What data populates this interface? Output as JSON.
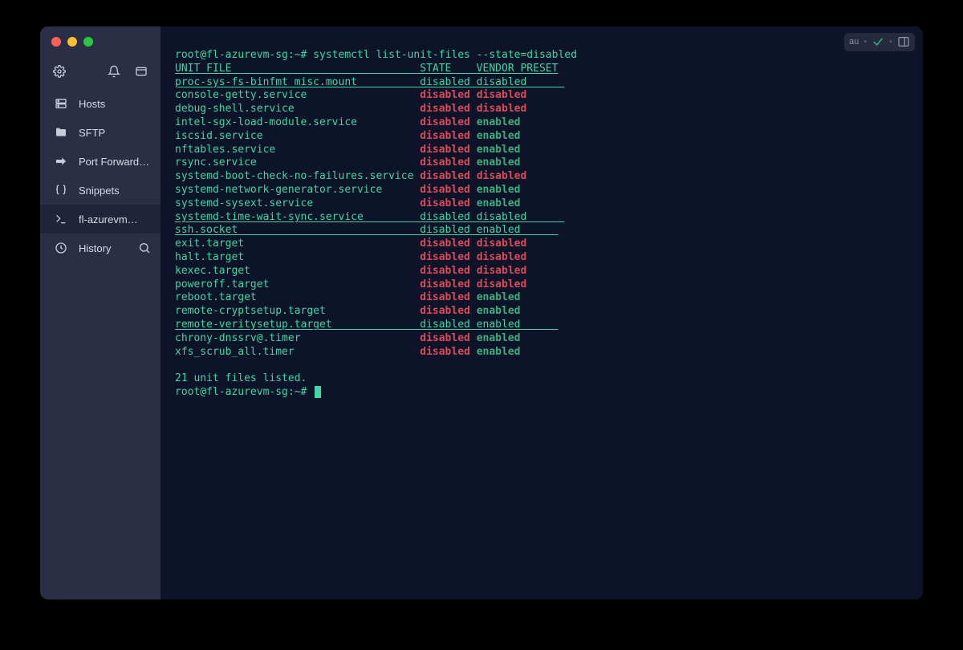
{
  "sidebar": {
    "items": [
      {
        "label": "Hosts"
      },
      {
        "label": "SFTP"
      },
      {
        "label": "Port Forwarding"
      },
      {
        "label": "Snippets"
      },
      {
        "label": "fl-azurevm…",
        "active": true
      },
      {
        "label": "History"
      }
    ]
  },
  "titlebar_badge": "au",
  "terminal": {
    "prompt": "root@fl-azurevm-sg:~#",
    "command": "systemctl list-unit-files --state=disabled",
    "header": {
      "unit": "UNIT FILE",
      "state": "STATE",
      "vendor": "VENDOR PRESET"
    },
    "rows": [
      {
        "unit": "proc-sys-fs-binfmt_misc.mount",
        "state": "disabled",
        "vendor": "disabled",
        "link": true
      },
      {
        "unit": "console-getty.service",
        "state": "disabled",
        "vendor": "disabled"
      },
      {
        "unit": "debug-shell.service",
        "state": "disabled",
        "vendor": "disabled"
      },
      {
        "unit": "intel-sgx-load-module.service",
        "state": "disabled",
        "vendor": "enabled"
      },
      {
        "unit": "iscsid.service",
        "state": "disabled",
        "vendor": "enabled"
      },
      {
        "unit": "nftables.service",
        "state": "disabled",
        "vendor": "enabled"
      },
      {
        "unit": "rsync.service",
        "state": "disabled",
        "vendor": "enabled"
      },
      {
        "unit": "systemd-boot-check-no-failures.service",
        "state": "disabled",
        "vendor": "disabled"
      },
      {
        "unit": "systemd-network-generator.service",
        "state": "disabled",
        "vendor": "enabled"
      },
      {
        "unit": "systemd-sysext.service",
        "state": "disabled",
        "vendor": "enabled"
      },
      {
        "unit": "systemd-time-wait-sync.service",
        "state": "disabled",
        "vendor": "disabled",
        "link": true
      },
      {
        "unit": "ssh.socket",
        "state": "disabled",
        "vendor": "enabled",
        "link": true
      },
      {
        "unit": "exit.target",
        "state": "disabled",
        "vendor": "disabled"
      },
      {
        "unit": "halt.target",
        "state": "disabled",
        "vendor": "disabled"
      },
      {
        "unit": "kexec.target",
        "state": "disabled",
        "vendor": "disabled"
      },
      {
        "unit": "poweroff.target",
        "state": "disabled",
        "vendor": "disabled"
      },
      {
        "unit": "reboot.target",
        "state": "disabled",
        "vendor": "enabled"
      },
      {
        "unit": "remote-cryptsetup.target",
        "state": "disabled",
        "vendor": "enabled"
      },
      {
        "unit": "remote-veritysetup.target",
        "state": "disabled",
        "vendor": "enabled",
        "link": true
      },
      {
        "unit": "chrony-dnssrv@.timer",
        "state": "disabled",
        "vendor": "enabled"
      },
      {
        "unit": "xfs_scrub_all.timer",
        "state": "disabled",
        "vendor": "enabled"
      }
    ],
    "footer": "21 unit files listed.",
    "col_unit_width": 39,
    "col_state_width": 9
  }
}
